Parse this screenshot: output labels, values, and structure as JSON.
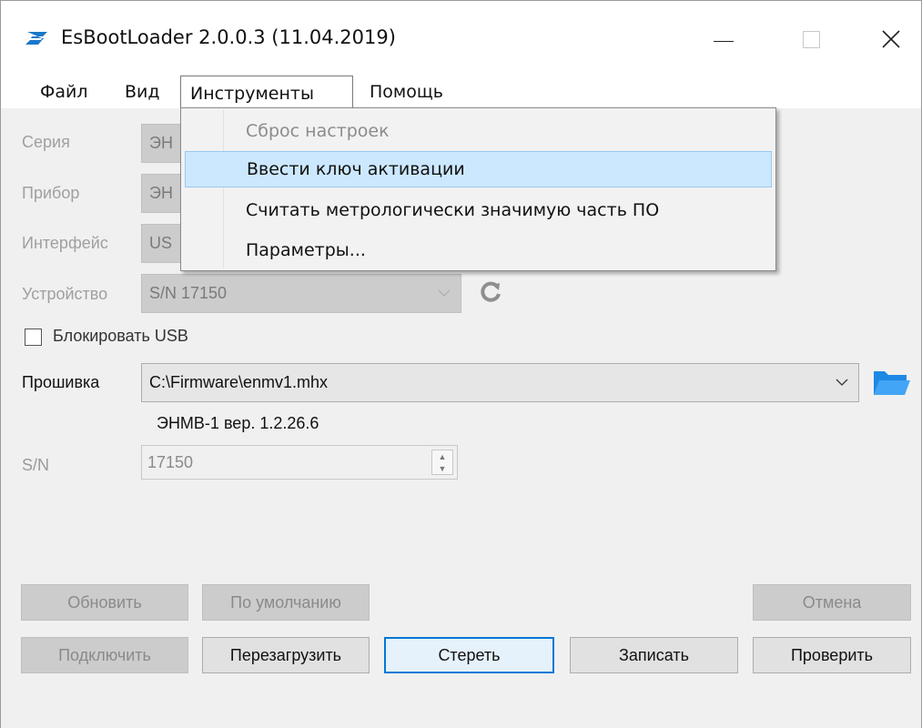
{
  "window": {
    "title": "EsBootLoader 2.0.0.3 (11.04.2019)",
    "app_icon": "esbootloader-logo-icon",
    "controls": [
      "minimize-icon",
      "maximize-icon",
      "close-icon"
    ]
  },
  "menubar": {
    "items": [
      {
        "label": "Файл"
      },
      {
        "label": "Вид"
      },
      {
        "label": "Инструменты",
        "open": true
      },
      {
        "label": "Помощь"
      }
    ]
  },
  "tools_menu": {
    "items": [
      {
        "label": "Сброс настроек",
        "enabled": false
      },
      {
        "label": "Ввести ключ активации",
        "highlighted": true
      },
      {
        "label": "Считать метрологически значимую часть ПО"
      },
      {
        "label": "Параметры..."
      }
    ]
  },
  "form": {
    "series": {
      "label": "Серия",
      "value": "ЭН"
    },
    "device": {
      "label": "Прибор",
      "value": "ЭН"
    },
    "interface": {
      "label": "Интерфейс",
      "value": "US"
    },
    "unit": {
      "label": "Устройство",
      "value": "S/N 17150"
    },
    "block_usb": {
      "label": "Блокировать USB",
      "checked": false
    },
    "firmware": {
      "label": "Прошивка",
      "value": "C:\\Firmware\\enmv1.mhx",
      "info": "ЭНМВ-1 вер. 1.2.26.6"
    },
    "serial": {
      "label": "S/N",
      "value": "17150"
    }
  },
  "buttons": {
    "update": "Обновить",
    "default": "По умолчанию",
    "cancel": "Отмена",
    "connect": "Подключить",
    "reboot": "Перезагрузить",
    "erase": "Стереть",
    "write": "Записать",
    "verify": "Проверить"
  },
  "colors": {
    "accent": "#0078d7",
    "logo": "#1a78c8",
    "folder": "#1e88e5",
    "highlight": "#cce8ff"
  }
}
